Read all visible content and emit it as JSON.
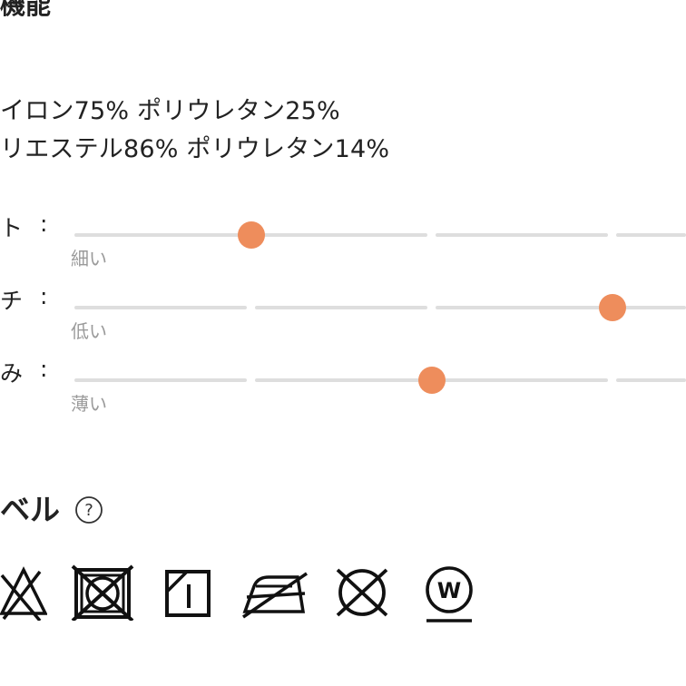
{
  "material": {
    "section_title": "機能",
    "lines": [
      "イロン75% ポリウレタン25%",
      "リエステル86% ポリウレタン14%"
    ]
  },
  "scales": [
    {
      "label": "ト",
      "colon": ":",
      "min_label": "細い",
      "value_fraction": 0.29
    },
    {
      "label": "チ",
      "colon": ":",
      "min_label": "低い",
      "value_fraction": 0.88
    },
    {
      "label": "み",
      "colon": ":",
      "min_label": "薄い",
      "value_fraction": 0.58
    }
  ],
  "care": {
    "title": "ベル",
    "help_icon_label": "?",
    "icons": [
      "no-bleach-icon",
      "no-tumble-dry-icon",
      "line-dry-shade-icon",
      "iron-low-icon",
      "no-dry-clean-icon",
      "wet-clean-icon"
    ],
    "wet_clean_letter": "W"
  },
  "colors": {
    "accent": "#ee8d5c",
    "track": "#dedede",
    "muted_text": "#9a9a9a",
    "text": "#222222"
  }
}
